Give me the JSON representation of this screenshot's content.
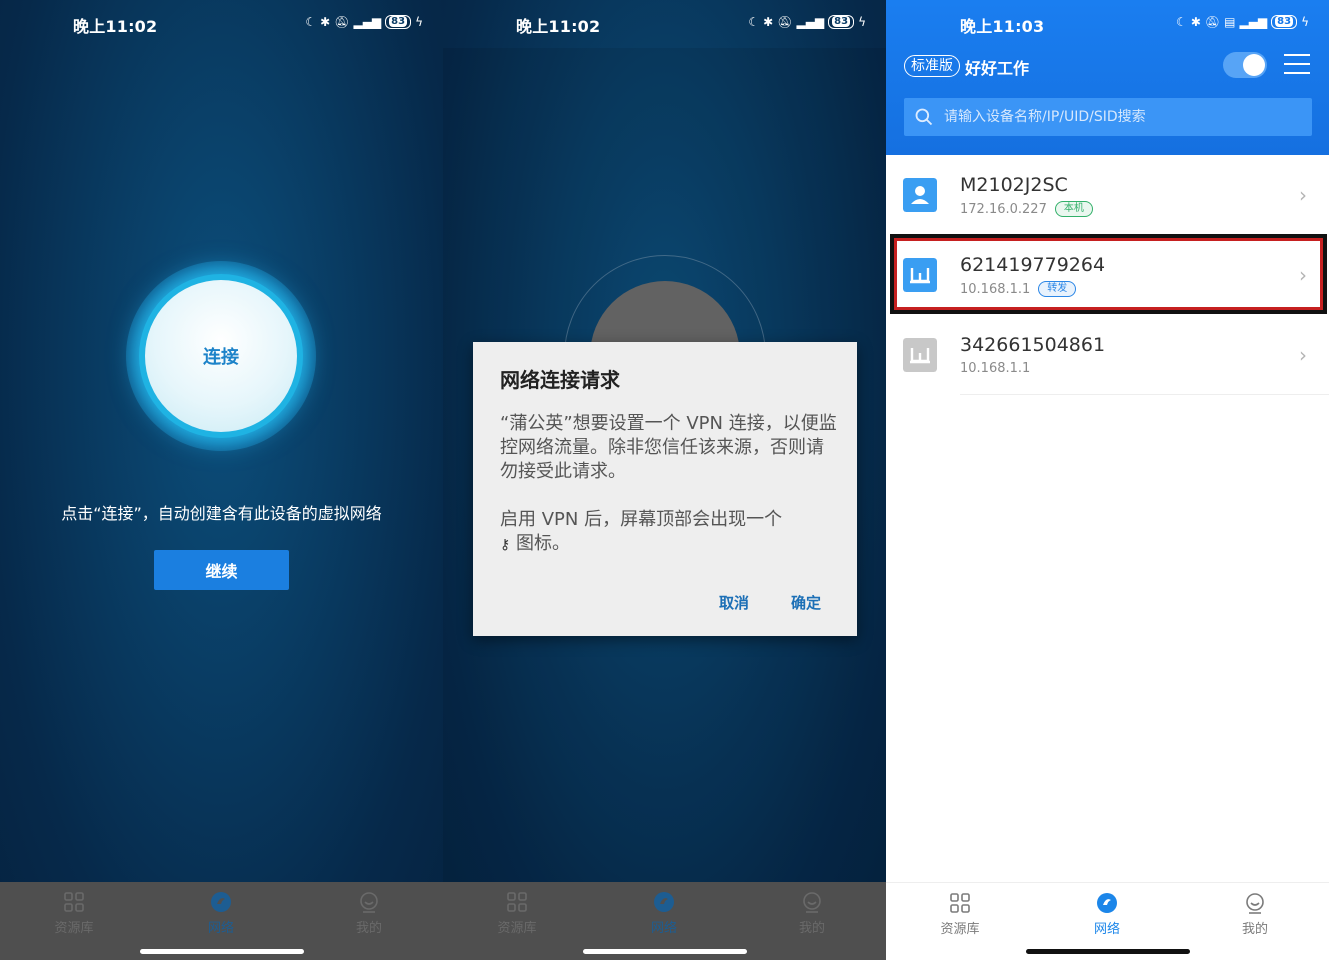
{
  "panel1": {
    "status": {
      "time": "晚上11:02",
      "battery": "83"
    },
    "connect_label": "连接",
    "hint": "点击“连接”，自动创建含有此设备的虚拟网络",
    "continue_label": "继续"
  },
  "panel2": {
    "status": {
      "time": "晚上11:02",
      "battery": "83"
    },
    "dialog": {
      "title": "网络连接请求",
      "body1": "“蒲公英”想要设置一个 VPN 连接，以便监控网络流量。除非您信任该来源，否则请勿接受此请求。",
      "body2_prefix": "启用 VPN 后，屏幕顶部会出现一个",
      "body2_suffix": "图标。",
      "cancel": "取消",
      "ok": "确定"
    }
  },
  "panel3": {
    "status": {
      "time": "晚上11:03",
      "battery": "83"
    },
    "edition": "标准版",
    "workspace": "好好工作",
    "toggle_on": true,
    "search_placeholder": "请输入设备名称/IP/UID/SID搜索",
    "devices": [
      {
        "name": "M2102J2SC",
        "ip": "172.16.0.227",
        "tag": "本机",
        "tag_color": "#33b06a",
        "icon": "phone-device-icon",
        "icon_color": "#3a9ef2"
      },
      {
        "name": "621419779264",
        "ip": "10.168.1.1",
        "tag": "转发",
        "tag_color": "#2b86e6",
        "icon": "router-icon",
        "icon_color": "#3a9ef2"
      },
      {
        "name": "342661504861",
        "ip": "10.168.1.1",
        "tag": "",
        "tag_color": "",
        "icon": "router-icon",
        "icon_color": "#c8c8c8"
      }
    ]
  },
  "nav": {
    "items": [
      {
        "label": "资源库",
        "icon": "grid-icon"
      },
      {
        "label": "网络",
        "icon": "network-icon"
      },
      {
        "label": "我的",
        "icon": "profile-icon"
      }
    ],
    "active_index": 1
  },
  "colors": {
    "brand_blue": "#1a7ef0",
    "highlight_red": "#c62020"
  }
}
